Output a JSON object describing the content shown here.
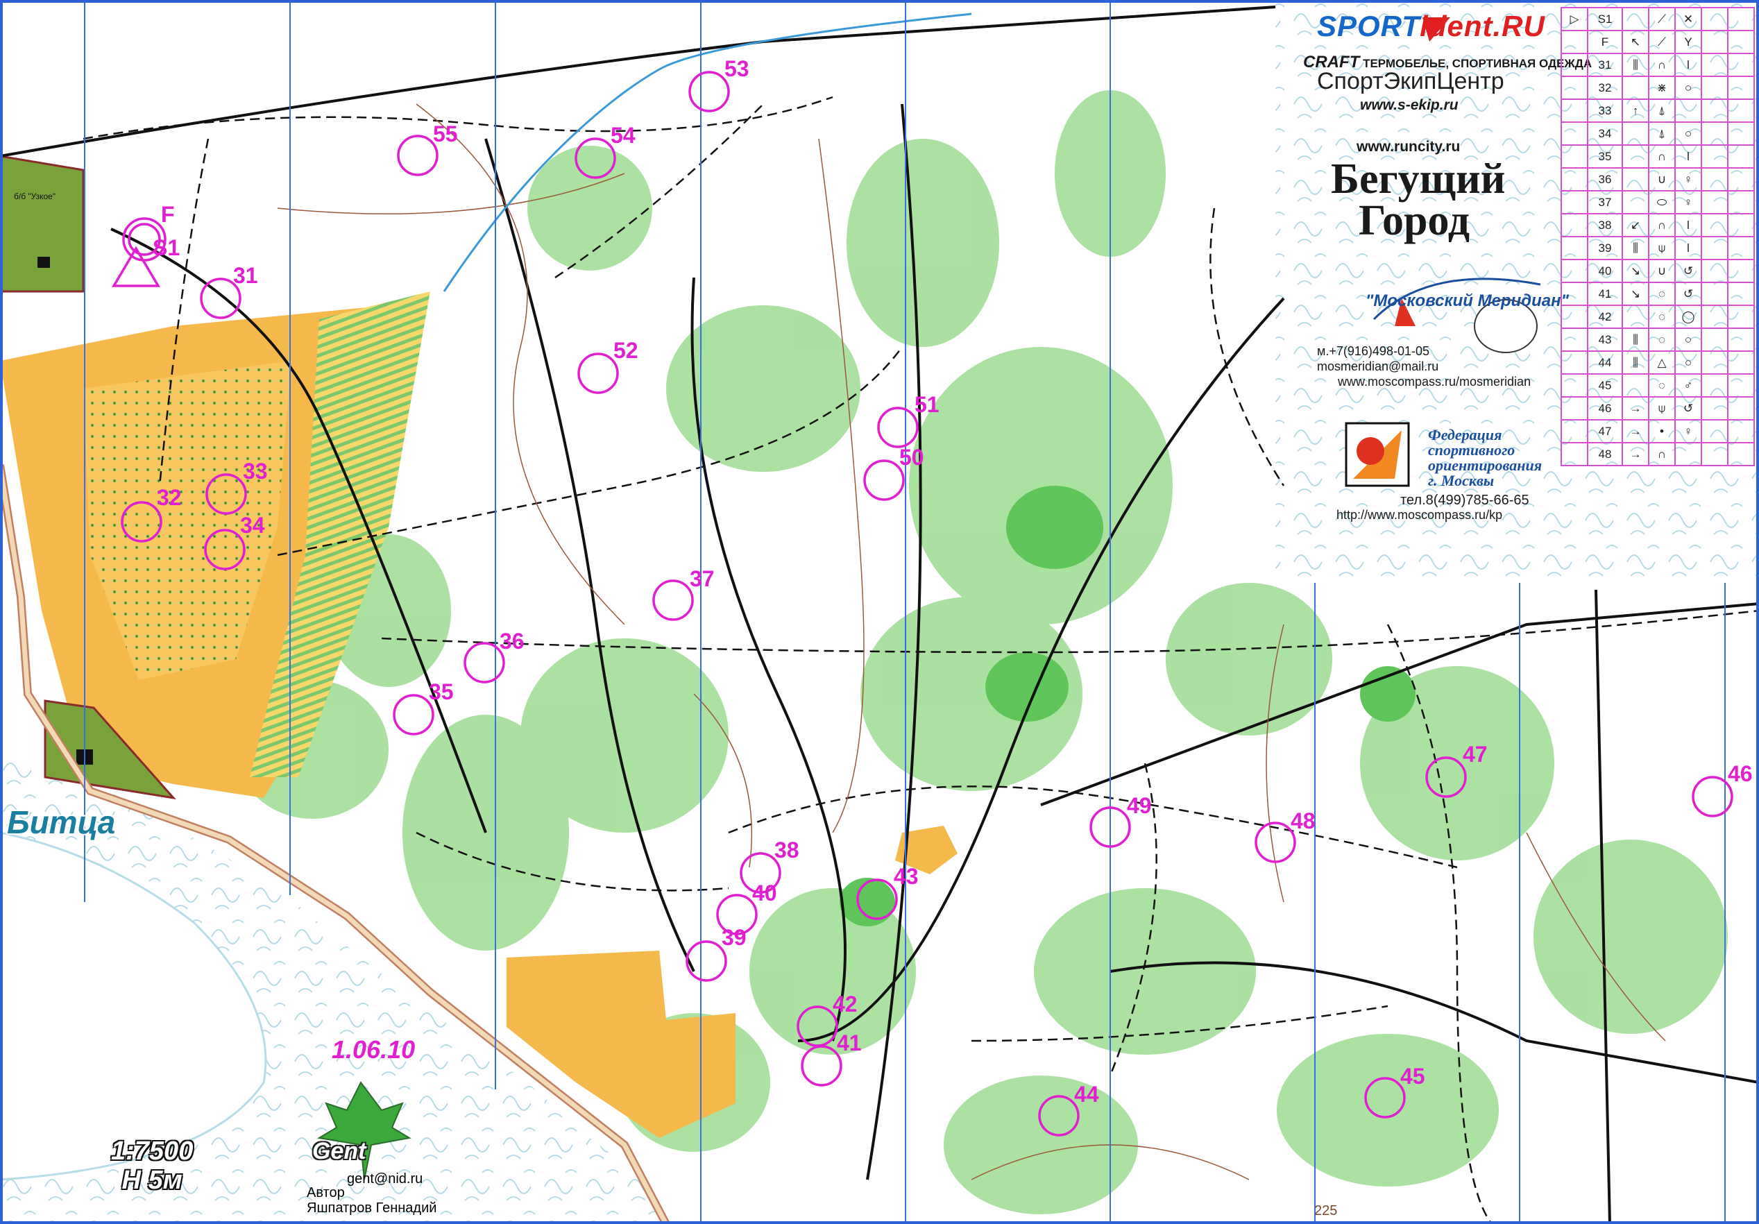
{
  "legend": {
    "sport": "SPORT",
    "ident": "ident.RU",
    "craft_brand": "CRAFT",
    "craft_text": "ТЕРМОБЕЛЬЕ, СПОРТИВНАЯ ОДЕЖДА",
    "sekip": "СпортЭкипЦентр",
    "sekip_url": "www.s-ekip.ru",
    "runcity_url": "www.runcity.ru",
    "begush_line1": "Бегущий",
    "begush_line2": "Город",
    "meridian_title": "\"Московский Меридиан\"",
    "meridian_phone": "м.+7(916)498-01-05",
    "meridian_mail": "mosmeridian@mail.ru",
    "meridian_url": "www.moscompass.ru/mosmeridian",
    "fed_line1": "Федерация",
    "fed_line2": "спортивного",
    "fed_line3": "ориентирования",
    "fed_line4": "г. Москвы",
    "fed_tel": "тел.8(499)785-66-65",
    "fed_url": "http://www.moscompass.ru/kp"
  },
  "control_descriptions": {
    "rows": [
      {
        "code": "S1",
        "c1": "",
        "c2": "⟋",
        "c3": "✕"
      },
      {
        "code": "F",
        "c1": "↖",
        "c2": "⟋",
        "c3": "Y"
      },
      {
        "code": "31",
        "c1": "⫼",
        "c2": "∩",
        "c3": "ǀ"
      },
      {
        "code": "32",
        "c1": "",
        "c2": "⋇",
        "c3": "○"
      },
      {
        "code": "33",
        "c1": "↑",
        "c2": "⍋",
        "c3": ""
      },
      {
        "code": "34",
        "c1": "",
        "c2": "⍋",
        "c3": "○"
      },
      {
        "code": "35",
        "c1": "",
        "c2": "∩",
        "c3": "ǀ"
      },
      {
        "code": "36",
        "c1": "",
        "c2": "∪",
        "c3": "♀"
      },
      {
        "code": "37",
        "c1": "",
        "c2": "⬭",
        "c3": "♀"
      },
      {
        "code": "38",
        "c1": "↙",
        "c2": "∩",
        "c3": "ǀ"
      },
      {
        "code": "39",
        "c1": "⫼",
        "c2": "⍦",
        "c3": "ǀ"
      },
      {
        "code": "40",
        "c1": "↘",
        "c2": "∪",
        "c3": "↺"
      },
      {
        "code": "41",
        "c1": "↘",
        "c2": "◌",
        "c3": "↺"
      },
      {
        "code": "42",
        "c1": "",
        "c2": "◌",
        "c3": "◯"
      },
      {
        "code": "43",
        "c1": "⫼",
        "c2": "◌",
        "c3": "○"
      },
      {
        "code": "44",
        "c1": "⫼",
        "c2": "△",
        "c3": "○"
      },
      {
        "code": "45",
        "c1": "",
        "c2": "◌",
        "c3": "♂"
      },
      {
        "code": "46",
        "c1": "→",
        "c2": "⍦",
        "c3": "↺"
      },
      {
        "code": "47",
        "c1": "→",
        "c2": "•",
        "c3": "♀"
      },
      {
        "code": "48",
        "c1": "→",
        "c2": "∩",
        "c3": ""
      }
    ]
  },
  "controls": [
    {
      "label": "F"
    },
    {
      "label": "S1"
    },
    {
      "label": "31"
    },
    {
      "label": "32"
    },
    {
      "label": "33"
    },
    {
      "label": "34"
    },
    {
      "label": "35"
    },
    {
      "label": "36"
    },
    {
      "label": "37"
    },
    {
      "label": "38"
    },
    {
      "label": "39"
    },
    {
      "label": "40"
    },
    {
      "label": "41"
    },
    {
      "label": "42"
    },
    {
      "label": "43"
    },
    {
      "label": "44"
    },
    {
      "label": "45"
    },
    {
      "label": "46"
    },
    {
      "label": "47"
    },
    {
      "label": "48"
    },
    {
      "label": "49"
    },
    {
      "label": "50"
    },
    {
      "label": "51"
    },
    {
      "label": "52"
    },
    {
      "label": "53"
    },
    {
      "label": "54"
    },
    {
      "label": "55"
    }
  ],
  "map_text": {
    "place": "Битца",
    "uzkoe": "б/б \"Узкое\"",
    "date": "1.06.10",
    "scale": "1:7500",
    "contour": "H 5м",
    "author_brand": "Gent",
    "author_mail": "gent@nid.ru",
    "author_label": "Автор",
    "author_name": "Яшпатров Геннадий",
    "contour_value": "225"
  },
  "colors": {
    "course": "#e020d0",
    "forest_green": "#8fd68a",
    "open_yellow": "#f5b84a",
    "meridian_blue": "#3a6fe0"
  }
}
